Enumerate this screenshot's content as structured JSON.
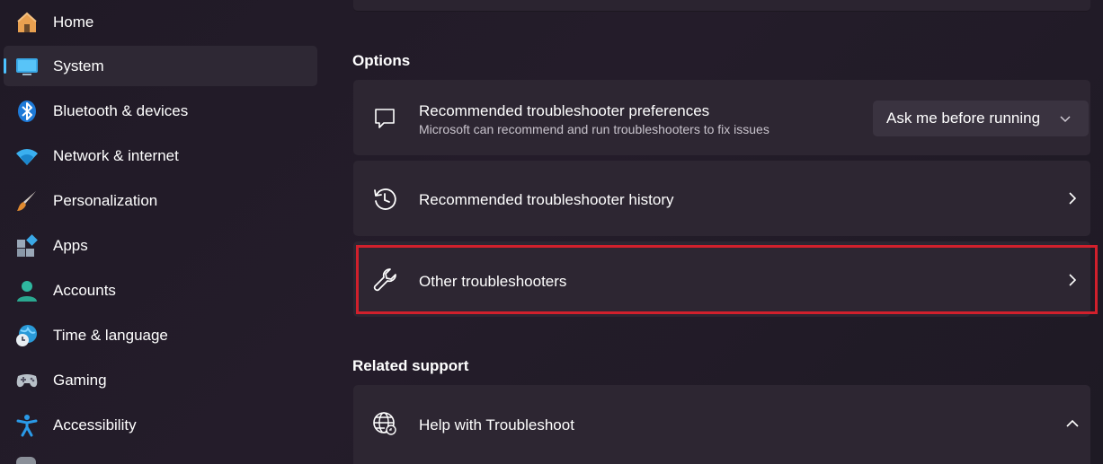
{
  "sidebar": {
    "items": [
      {
        "label": "Home",
        "icon": "home-icon",
        "selected": false
      },
      {
        "label": "System",
        "icon": "system-monitor-icon",
        "selected": true
      },
      {
        "label": "Bluetooth & devices",
        "icon": "bluetooth-icon",
        "selected": false
      },
      {
        "label": "Network & internet",
        "icon": "wifi-icon",
        "selected": false
      },
      {
        "label": "Personalization",
        "icon": "paintbrush-icon",
        "selected": false
      },
      {
        "label": "Apps",
        "icon": "apps-icon",
        "selected": false
      },
      {
        "label": "Accounts",
        "icon": "account-icon",
        "selected": false
      },
      {
        "label": "Time & language",
        "icon": "globe-clock-icon",
        "selected": false
      },
      {
        "label": "Gaming",
        "icon": "gamepad-icon",
        "selected": false
      },
      {
        "label": "Accessibility",
        "icon": "accessibility-icon",
        "selected": false
      }
    ]
  },
  "main": {
    "options_title": "Options",
    "preferences": {
      "title": "Recommended troubleshooter preferences",
      "subtitle": "Microsoft can recommend and run troubleshooters to fix issues",
      "dropdown_value": "Ask me before running",
      "icon": "chat-bubble-icon"
    },
    "history": {
      "title": "Recommended troubleshooter history",
      "icon": "history-icon"
    },
    "other": {
      "title": "Other troubleshooters",
      "icon": "wrench-icon",
      "highlighted": true
    },
    "related_title": "Related support",
    "help": {
      "title": "Help with Troubleshoot",
      "icon": "globe-icon",
      "expanded": true
    }
  },
  "colors": {
    "accent": "#4cc2ff",
    "highlight_border": "#d1202c",
    "card_bg": "#2d2632"
  }
}
